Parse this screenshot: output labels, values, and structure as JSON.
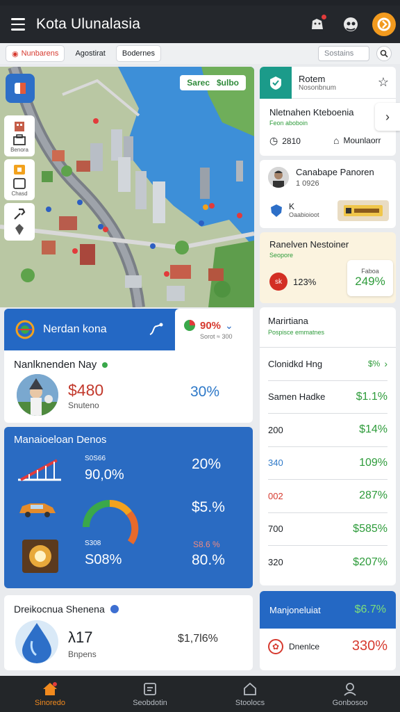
{
  "app": {
    "title": "Kota Ulunalasia"
  },
  "filters": {
    "chip1": "Nunbarens",
    "chip2": "Agostirat",
    "chip3": "Bodernes",
    "search_placeholder": "Sostains"
  },
  "map": {
    "badge_left": "Sarec",
    "badge_right": "$ulbo",
    "tool2_label": "Benora",
    "tool4_label": "Chasd"
  },
  "nav_card": {
    "header_title": "Nerdan kona",
    "header_pct": "90%",
    "header_sub": "Sorot ≈ 300",
    "title": "Nanlknenden Nay",
    "price": "$480",
    "sub": "Snuteno",
    "pct": "30%"
  },
  "dashboard": {
    "title": "Manaioeloan Denos",
    "row1_small": "S0S66",
    "row1_value": "90,0%",
    "row1_right": "20%",
    "row2_right": "$5.%",
    "row3_small": "S308",
    "row3_value": "S08%",
    "row3_right_small": "S8.6 %",
    "row3_right": "80.%"
  },
  "bottom_left": {
    "title": "Dreikocnua Shenena",
    "value": "λ17",
    "sub": "Bnpens",
    "right": "$1,7l6%"
  },
  "right1": {
    "title": "Rotem",
    "sub": "Nosonbnum",
    "heading": "Nletnahen Kteboenia",
    "heading_sub": "Feon aboboin",
    "stat1": "2810",
    "stat2": "Mounlaorr"
  },
  "right2": {
    "title": "Canabape Panoren",
    "sub": "1 0926",
    "tag": "K",
    "tag_sub": "Oaabioioot"
  },
  "right3": {
    "title": "Ranelven Nestoiner",
    "sub": "Seopore",
    "badge": "sk",
    "pct": "123%",
    "box_small": "Faboa",
    "box_pct": "249%"
  },
  "right_list": {
    "title": "Marirtiana",
    "sub": "Pospisce emmatnes",
    "rows": [
      {
        "label": "Clonidkd Hng",
        "val": "$%"
      },
      {
        "label": "Samen Hadke",
        "val": "$1.1%"
      },
      {
        "label": "200",
        "val": "$14%"
      },
      {
        "label": "340",
        "val": "109%"
      },
      {
        "label": "002",
        "val": "287%"
      },
      {
        "label": "700",
        "val": "$585%"
      },
      {
        "label": "320",
        "val": "$207%"
      }
    ]
  },
  "right_bottom": {
    "title": "Manjoneluiat",
    "title_pct": "$6.7%",
    "label": "Dnenlce",
    "pct": "330%"
  },
  "bottom_nav": [
    "Sinoredo",
    "Seobdotin",
    "Stoolocs",
    "Gonbosoo"
  ],
  "colors": {
    "accent_blue": "#2468c4",
    "accent_orange": "#f28a1e",
    "positive_green": "#2d9b3a",
    "negative_red": "#d63a2f"
  }
}
